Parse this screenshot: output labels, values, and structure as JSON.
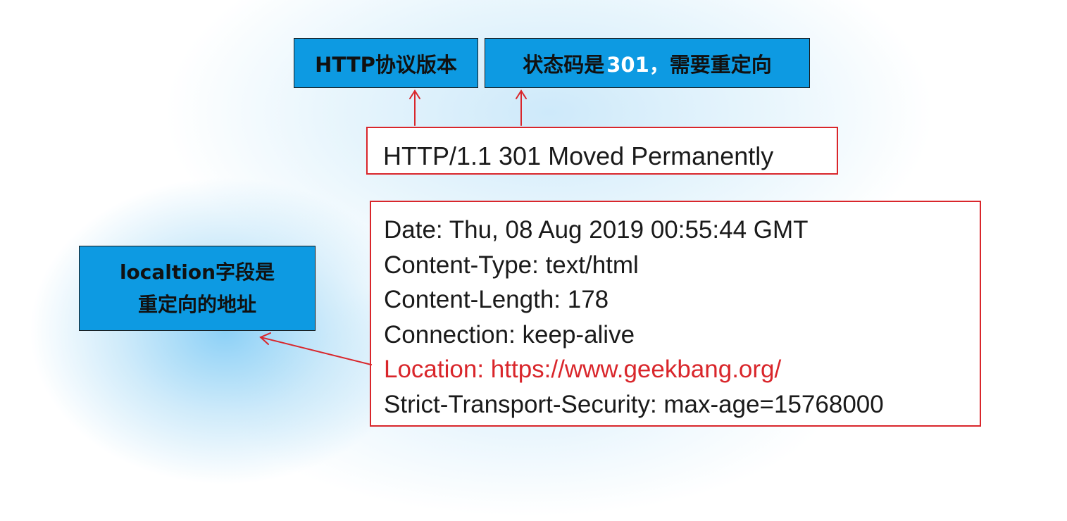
{
  "labels": {
    "version_label": "HTTP协议版本",
    "status_label_prefix": "状态码是",
    "status_label_code": "301，",
    "status_label_suffix": "需要重定向",
    "location_label_line1": "localtion字段是",
    "location_label_line2": "重定向的地址"
  },
  "status_line": "HTTP/1.1 301 Moved Permanently",
  "headers": [
    "Date: Thu, 08 Aug 2019 00:55:44 GMT",
    "Content-Type: text/html",
    "Content-Length: 178",
    "Connection: keep-alive",
    "Location: https://www.geekbang.org/",
    "Strict-Transport-Security: max-age=15768000"
  ],
  "colors": {
    "label_fill": "#0d9ae2",
    "box_border": "#d9262b",
    "highlight_text": "#d9262b",
    "glow": "#8fd0f5"
  }
}
